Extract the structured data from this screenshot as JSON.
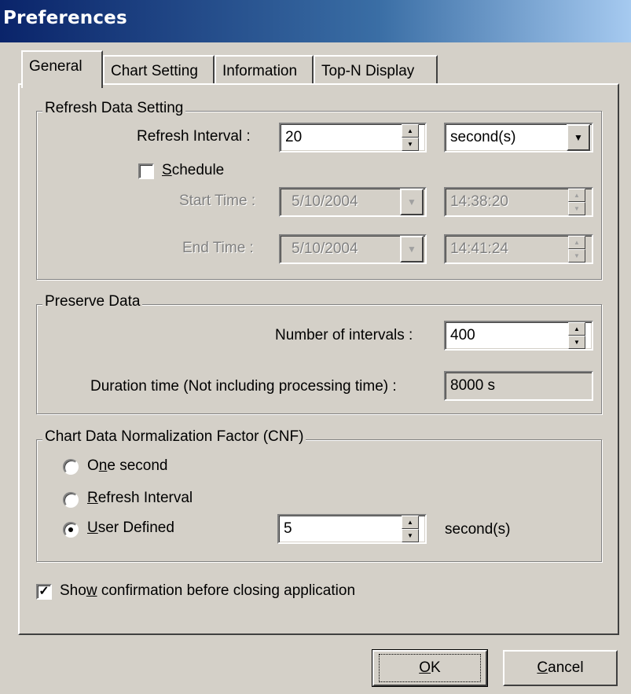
{
  "window": {
    "title": "Preferences"
  },
  "tabs": [
    {
      "label": "General",
      "active": true
    },
    {
      "label": "Chart Setting",
      "active": false
    },
    {
      "label": "Information",
      "active": false
    },
    {
      "label": "Top-N Display",
      "active": false
    }
  ],
  "refresh": {
    "group_title": "Refresh Data Setting",
    "interval_label": "Refresh Interval :",
    "interval_value": "20",
    "unit_value": "second(s)",
    "schedule_checked": false,
    "schedule_label_pre": "",
    "schedule_label_ul": "S",
    "schedule_label_post": "chedule",
    "start_label": "Start Time :",
    "start_date": "5/10/2004",
    "start_time": "14:38:20",
    "end_label": "End Time :",
    "end_date": "5/10/2004",
    "end_time": "14:41:24"
  },
  "preserve": {
    "group_title": "Preserve Data",
    "intervals_label": "Number of intervals :",
    "intervals_value": "400",
    "duration_label": "Duration time (Not including processing time) :",
    "duration_value": "8000 s"
  },
  "cnf": {
    "group_title": "Chart Data Normalization Factor (CNF)",
    "options": [
      {
        "pre": "O",
        "ul": "n",
        "post": "e second",
        "selected": false
      },
      {
        "pre": "",
        "ul": "R",
        "post": "efresh Interval",
        "selected": false
      },
      {
        "pre": "",
        "ul": "U",
        "post": "ser Defined",
        "selected": true
      }
    ],
    "user_value": "5",
    "user_unit": "second(s)"
  },
  "confirm": {
    "checked": true,
    "label_pre": "Sho",
    "label_ul": "w",
    "label_post": " confirmation before closing application"
  },
  "buttons": {
    "ok_ul": "O",
    "ok_post": "K",
    "cancel_ul": "C",
    "cancel_post": "ancel"
  },
  "icons": {
    "spin_up": "▲",
    "spin_down": "▼",
    "dropdown": "▼",
    "check": "✓"
  }
}
